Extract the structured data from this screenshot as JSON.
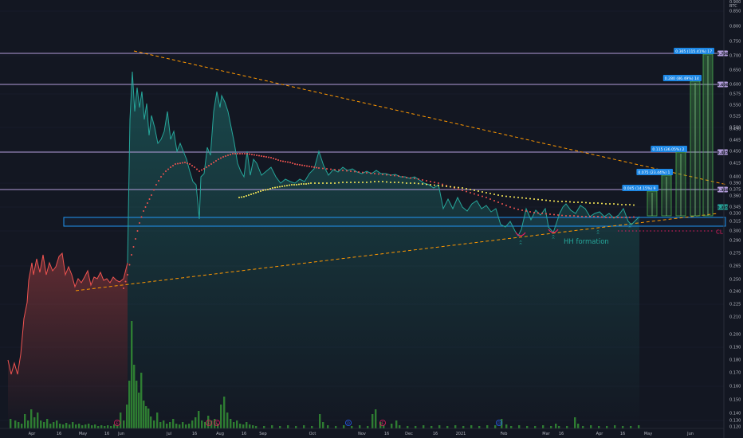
{
  "axis": {
    "top_labels": [
      "0.900",
      "BTC"
    ],
    "y_ticks": [
      0.85,
      0.8,
      0.75,
      0.7,
      0.65,
      0.6,
      0.575,
      0.55,
      0.525,
      0.5,
      0.49,
      0.465,
      0.45,
      0.415,
      0.4,
      0.39,
      0.375,
      0.36,
      0.345,
      0.33,
      0.315,
      0.3,
      0.29,
      0.275,
      0.265,
      0.25,
      0.24,
      0.225,
      0.21,
      0.2,
      0.19,
      0.18,
      0.17,
      0.16,
      0.15,
      0.14,
      0.13,
      0.12
    ],
    "x_ticks": [
      "Apr",
      "16",
      "May",
      "16",
      "Jun",
      "Jul",
      "16",
      "Aug",
      "16",
      "Sep",
      "Oct",
      "Nov",
      "16",
      "Dec",
      "16",
      "2021",
      "Feb",
      "Mar",
      "16",
      "Apr",
      "16",
      "May",
      "Jun"
    ]
  },
  "level_tags": [
    {
      "text": "0.700",
      "color": "#b39ddb"
    },
    {
      "text": "0.600",
      "color": "#b39ddb"
    },
    {
      "text": "0.425",
      "color": "#b39ddb"
    },
    {
      "text": "0.360",
      "color": "#b39ddb"
    },
    {
      "text": "0.335",
      "color": "#26a69a"
    }
  ],
  "target_boxes": [
    "0.045 (14.15%) 9",
    "0.075 (23.44%) 1",
    "0.115 (36.05%) 2",
    "0.280 (86.49%) 14",
    "0.365 (115.41%) 17"
  ],
  "annotations": {
    "pattern": "HH formation",
    "cl": "CL"
  },
  "event_markers": [
    "E",
    "E",
    "D",
    "E",
    "D",
    "E"
  ],
  "colors": {
    "background": "#131722",
    "price_up": "#26a69a",
    "price_down": "#ef5350",
    "level_line": "#b39ddb",
    "trendline": "#ff9800",
    "ma_red": "#ef5350",
    "ma_yellow": "#ffee58",
    "support_box": "#2196f3",
    "target_box": "#1e88e5",
    "volume": "#2e7d32"
  },
  "chart_data": {
    "type": "line",
    "title": "",
    "ylabel": "BTC",
    "ylim": [
      0.12,
      0.9
    ],
    "price_series": {
      "x": [
        "Mar",
        "Apr",
        "Apr 16",
        "May",
        "May 16",
        "Jun",
        "Jun 8",
        "Jul",
        "Jul 16",
        "Aug",
        "Aug 16",
        "Sep",
        "Oct",
        "Nov",
        "Nov 16",
        "Dec",
        "Dec 16",
        "2021",
        "Feb",
        "Feb 16",
        "Mar",
        "Mar 16",
        "Apr",
        "Apr 16",
        "Apr 30"
      ],
      "y": [
        0.16,
        0.245,
        0.25,
        0.255,
        0.245,
        0.245,
        0.6,
        0.32,
        0.35,
        0.45,
        0.36,
        0.38,
        0.39,
        0.37,
        0.37,
        0.36,
        0.35,
        0.34,
        0.31,
        0.305,
        0.31,
        0.33,
        0.32,
        0.31,
        0.315
      ]
    },
    "support_zone": [
      0.305,
      0.32
    ],
    "horizontal_levels": [
      0.7,
      0.6,
      0.425,
      0.36
    ],
    "targets": [
      0.045,
      0.075,
      0.115,
      0.28,
      0.365
    ],
    "target_percents": [
      14.15,
      23.44,
      36.05,
      86.49,
      115.41
    ],
    "moving_averages": [
      "red dotted",
      "yellow dotted"
    ],
    "volume": "bars"
  }
}
